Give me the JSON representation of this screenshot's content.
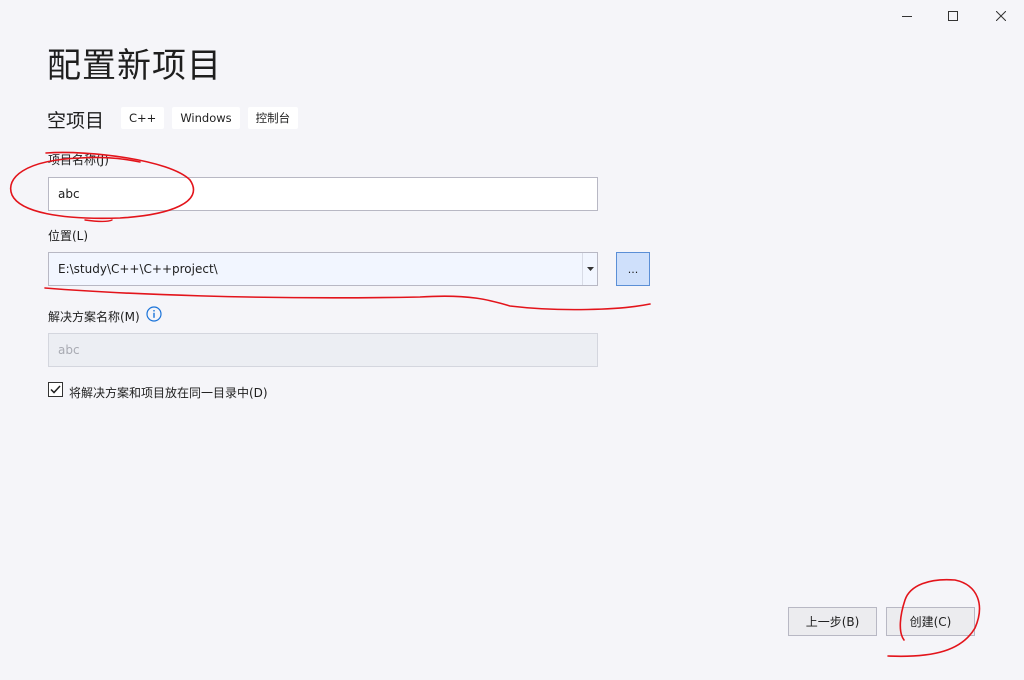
{
  "window": {
    "minimize_icon": "minimize-icon",
    "maximize_icon": "maximize-icon",
    "close_icon": "close-icon"
  },
  "header": {
    "title": "配置新项目",
    "template_name": "空项目",
    "tags": [
      "C++",
      "Windows",
      "控制台"
    ]
  },
  "form": {
    "project_name": {
      "label": "项目名称(J)",
      "value": "abc"
    },
    "location": {
      "label": "位置(L)",
      "value": "E:\\study\\C++\\C++project\\",
      "browse_label": "..."
    },
    "solution_name": {
      "label": "解决方案名称(M)",
      "value": "abc",
      "enabled": false
    },
    "same_dir": {
      "label": "将解决方案和项目放在同一目录中(D)",
      "checked": true
    }
  },
  "footer": {
    "back_label": "上一步(B)",
    "create_label": "创建(C)"
  },
  "colors": {
    "background": "#f5f5f9",
    "annotation_red": "#e3141b",
    "browse_accent": "#5b8fd6"
  }
}
